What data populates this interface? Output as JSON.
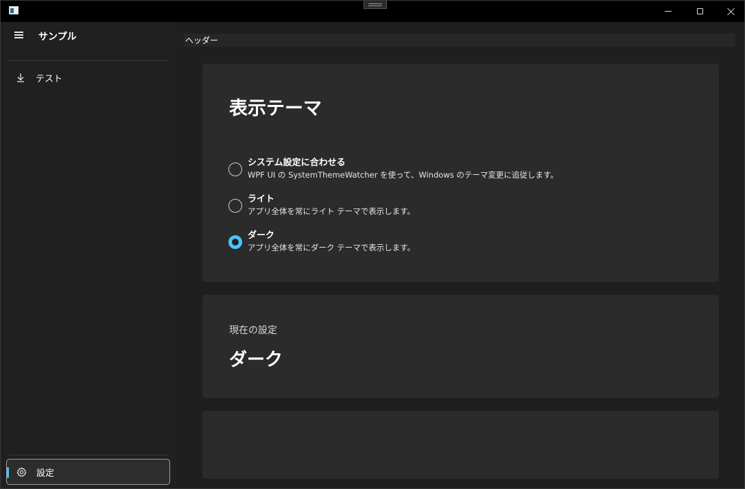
{
  "window": {
    "app_icon": "app-window-icon",
    "caption_buttons": [
      "minimize-icon",
      "maximize-icon",
      "close-icon"
    ]
  },
  "sidebar": {
    "menu_icon": "hamburger-icon",
    "app_title": "サンプル",
    "items": [
      {
        "label": "テスト",
        "icon": "download-arrow-icon"
      }
    ],
    "footer_items": [
      {
        "label": "設定",
        "icon": "gear-icon",
        "selected": true
      }
    ]
  },
  "header": {
    "title": "ヘッダー"
  },
  "theme_card": {
    "title": "表示テーマ",
    "options": [
      {
        "title": "システム設定に合わせる",
        "description": "WPF UI の SystemThemeWatcher を使って、Windows のテーマ変更に追従します。",
        "checked": false
      },
      {
        "title": "ライト",
        "description": "アプリ全体を常にライト テーマで表示します。",
        "checked": false
      },
      {
        "title": "ダーク",
        "description": "アプリ全体を常にダーク テーマで表示します。",
        "checked": true
      }
    ]
  },
  "current_card": {
    "label": "現在の設定",
    "value": "ダーク"
  },
  "colors": {
    "accent": "#4cc2ff",
    "background": "#202020",
    "card": "#2b2b2b",
    "titlebar": "#000000"
  }
}
